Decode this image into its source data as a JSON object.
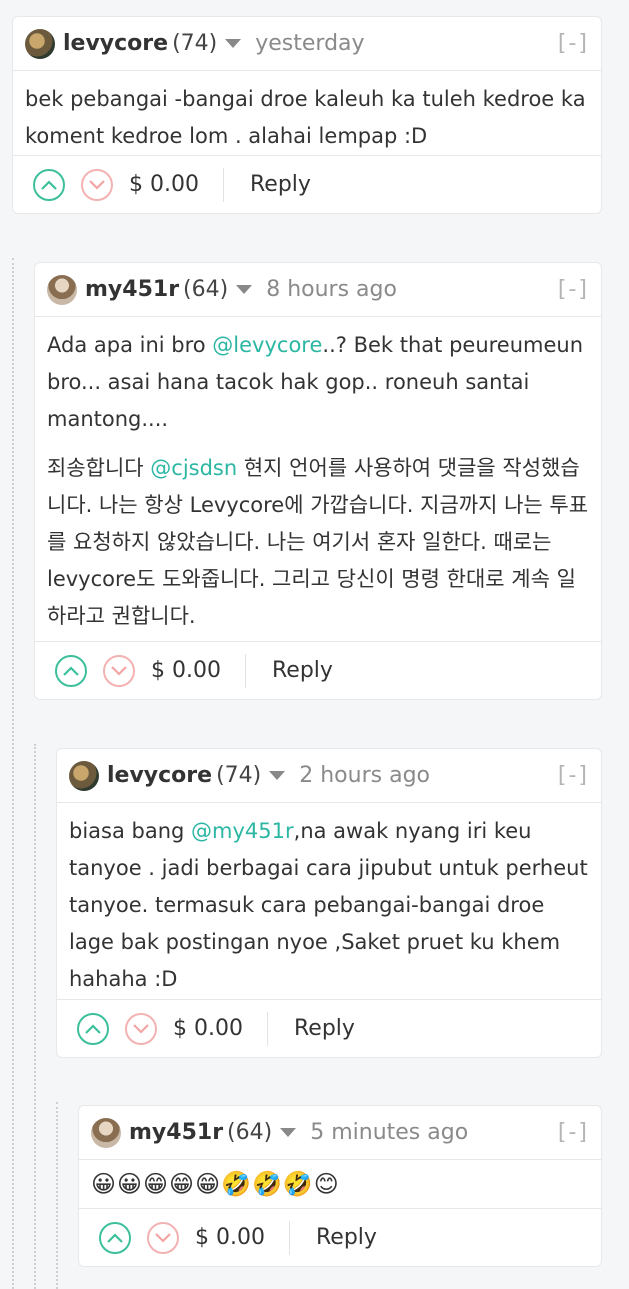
{
  "comments": [
    {
      "user": "levycore",
      "rep": "(74)",
      "time": "yesterday",
      "collapse": "[-]",
      "body": "bek pebangai -bangai droe kaleuh ka tuleh kedroe ka koment kedroe lom . alahai lempap :D",
      "payout": "$ 0.00",
      "reply": "Reply"
    },
    {
      "user": "my451r",
      "rep": "(64)",
      "time": "8 hours ago",
      "collapse": "[-]",
      "body_pre": "Ada apa ini bro ",
      "mention1": "@levycore",
      "body_post": "..? Bek that peureumeun bro... asai hana tacok hak gop.. roneuh santai mantong....",
      "p2_pre": "죄송합니다 ",
      "mention2": "@cjsdsn",
      "p2_post": " 현지 언어를 사용하여 댓글을 작성했습니다. 나는 항상 Levycore에 가깝습니다. 지금까지 나는 투표를 요청하지 않았습니다. 나는 여기서 혼자 일한다. 때로는 levycore도 도와줍니다. 그리고 당신이 명령 한대로 계속 일하라고 권합니다.",
      "payout": "$ 0.00",
      "reply": "Reply"
    },
    {
      "user": "levycore",
      "rep": "(74)",
      "time": "2 hours ago",
      "collapse": "[-]",
      "body_pre": "biasa bang ",
      "mention1": "@my451r",
      "body_post": ",na awak nyang iri keu tanyoe . jadi berbagai cara jipubut untuk perheut tanyoe. termasuk cara pebangai-bangai droe lage bak postingan nyoe ,Saket pruet ku khem hahaha :D",
      "payout": "$ 0.00",
      "reply": "Reply"
    },
    {
      "user": "my451r",
      "rep": "(64)",
      "time": "5 minutes ago",
      "collapse": "[-]",
      "body": "😀😀😁😁😁🤣🤣🤣😊",
      "payout": "$ 0.00",
      "reply": "Reply"
    }
  ],
  "colors": {
    "upvote": "#3cc09b",
    "downvote": "#f3b2b2",
    "mention": "#2bb7a3"
  }
}
